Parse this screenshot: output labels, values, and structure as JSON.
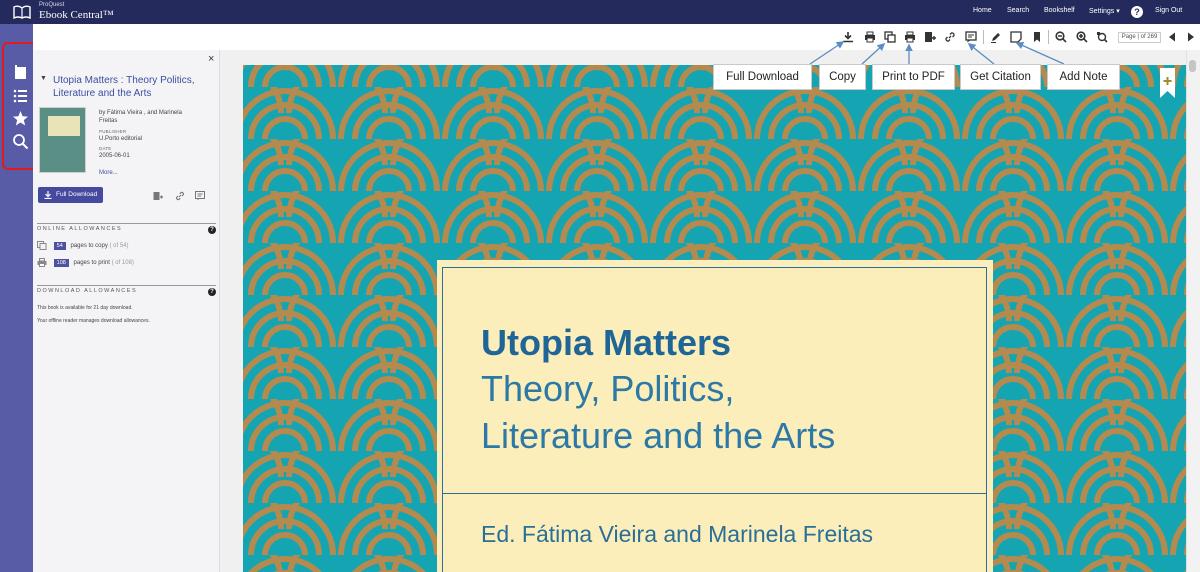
{
  "app": {
    "brand_small": "ProQuest",
    "brand_main": "Ebook Central™"
  },
  "nav": {
    "home": "Home",
    "search": "Search",
    "bookshelf": "Bookshelf",
    "settings": "Settings ▾",
    "help": "?",
    "signout": "Sign Out"
  },
  "sidebar": {
    "close": "×",
    "title": "Utopia Matters : Theory Politics, Literature and the Arts",
    "authors": "by Fátima Vieira , and Marinela",
    "authors2": "Freitas",
    "publisher_label": "PUBLISHER",
    "publisher": "U.Porto editorial",
    "date_label": "DATE",
    "date": "2005-06-01",
    "more": "More...",
    "full_download": "Full Download",
    "online_allowances": "ONLINE ALLOWANCES",
    "copy_count": "54",
    "copy_text": "pages to copy",
    "copy_of": "( of 54)",
    "print_count": "108",
    "print_text": "pages to print",
    "print_of": "( of 108)",
    "download_allowances": "DOWNLOAD ALLOWANCES",
    "dl_line1": "This book is available for 21 day download.",
    "dl_line2": "Your offline reader manages download allowances."
  },
  "toolbar": {
    "page_indicator": "Page | of 269"
  },
  "tooltips": {
    "full_download": "Full Download",
    "copy": "Copy",
    "print_pdf": "Print to PDF",
    "get_citation": "Get Citation",
    "add_note": "Add Note"
  },
  "cover": {
    "title": "Utopia Matters",
    "subtitle1": "Theory, Politics,",
    "subtitle2": "Literature and the Arts",
    "editors": "Ed. Fátima Vieira and Marinela Freitas"
  },
  "colors": {
    "nav_bg": "#252a5c",
    "strip_bg": "#585ca6",
    "cover_teal": "#14a4b2",
    "cover_gold": "#b58a4e",
    "cover_cream": "#fbeeba",
    "title_blue": "#1f6697",
    "highlight": "#e01b1b"
  },
  "icons": {
    "brand": "open-book-icon",
    "strip": [
      "book-icon",
      "list-icon",
      "star-icon",
      "search-icon"
    ]
  }
}
